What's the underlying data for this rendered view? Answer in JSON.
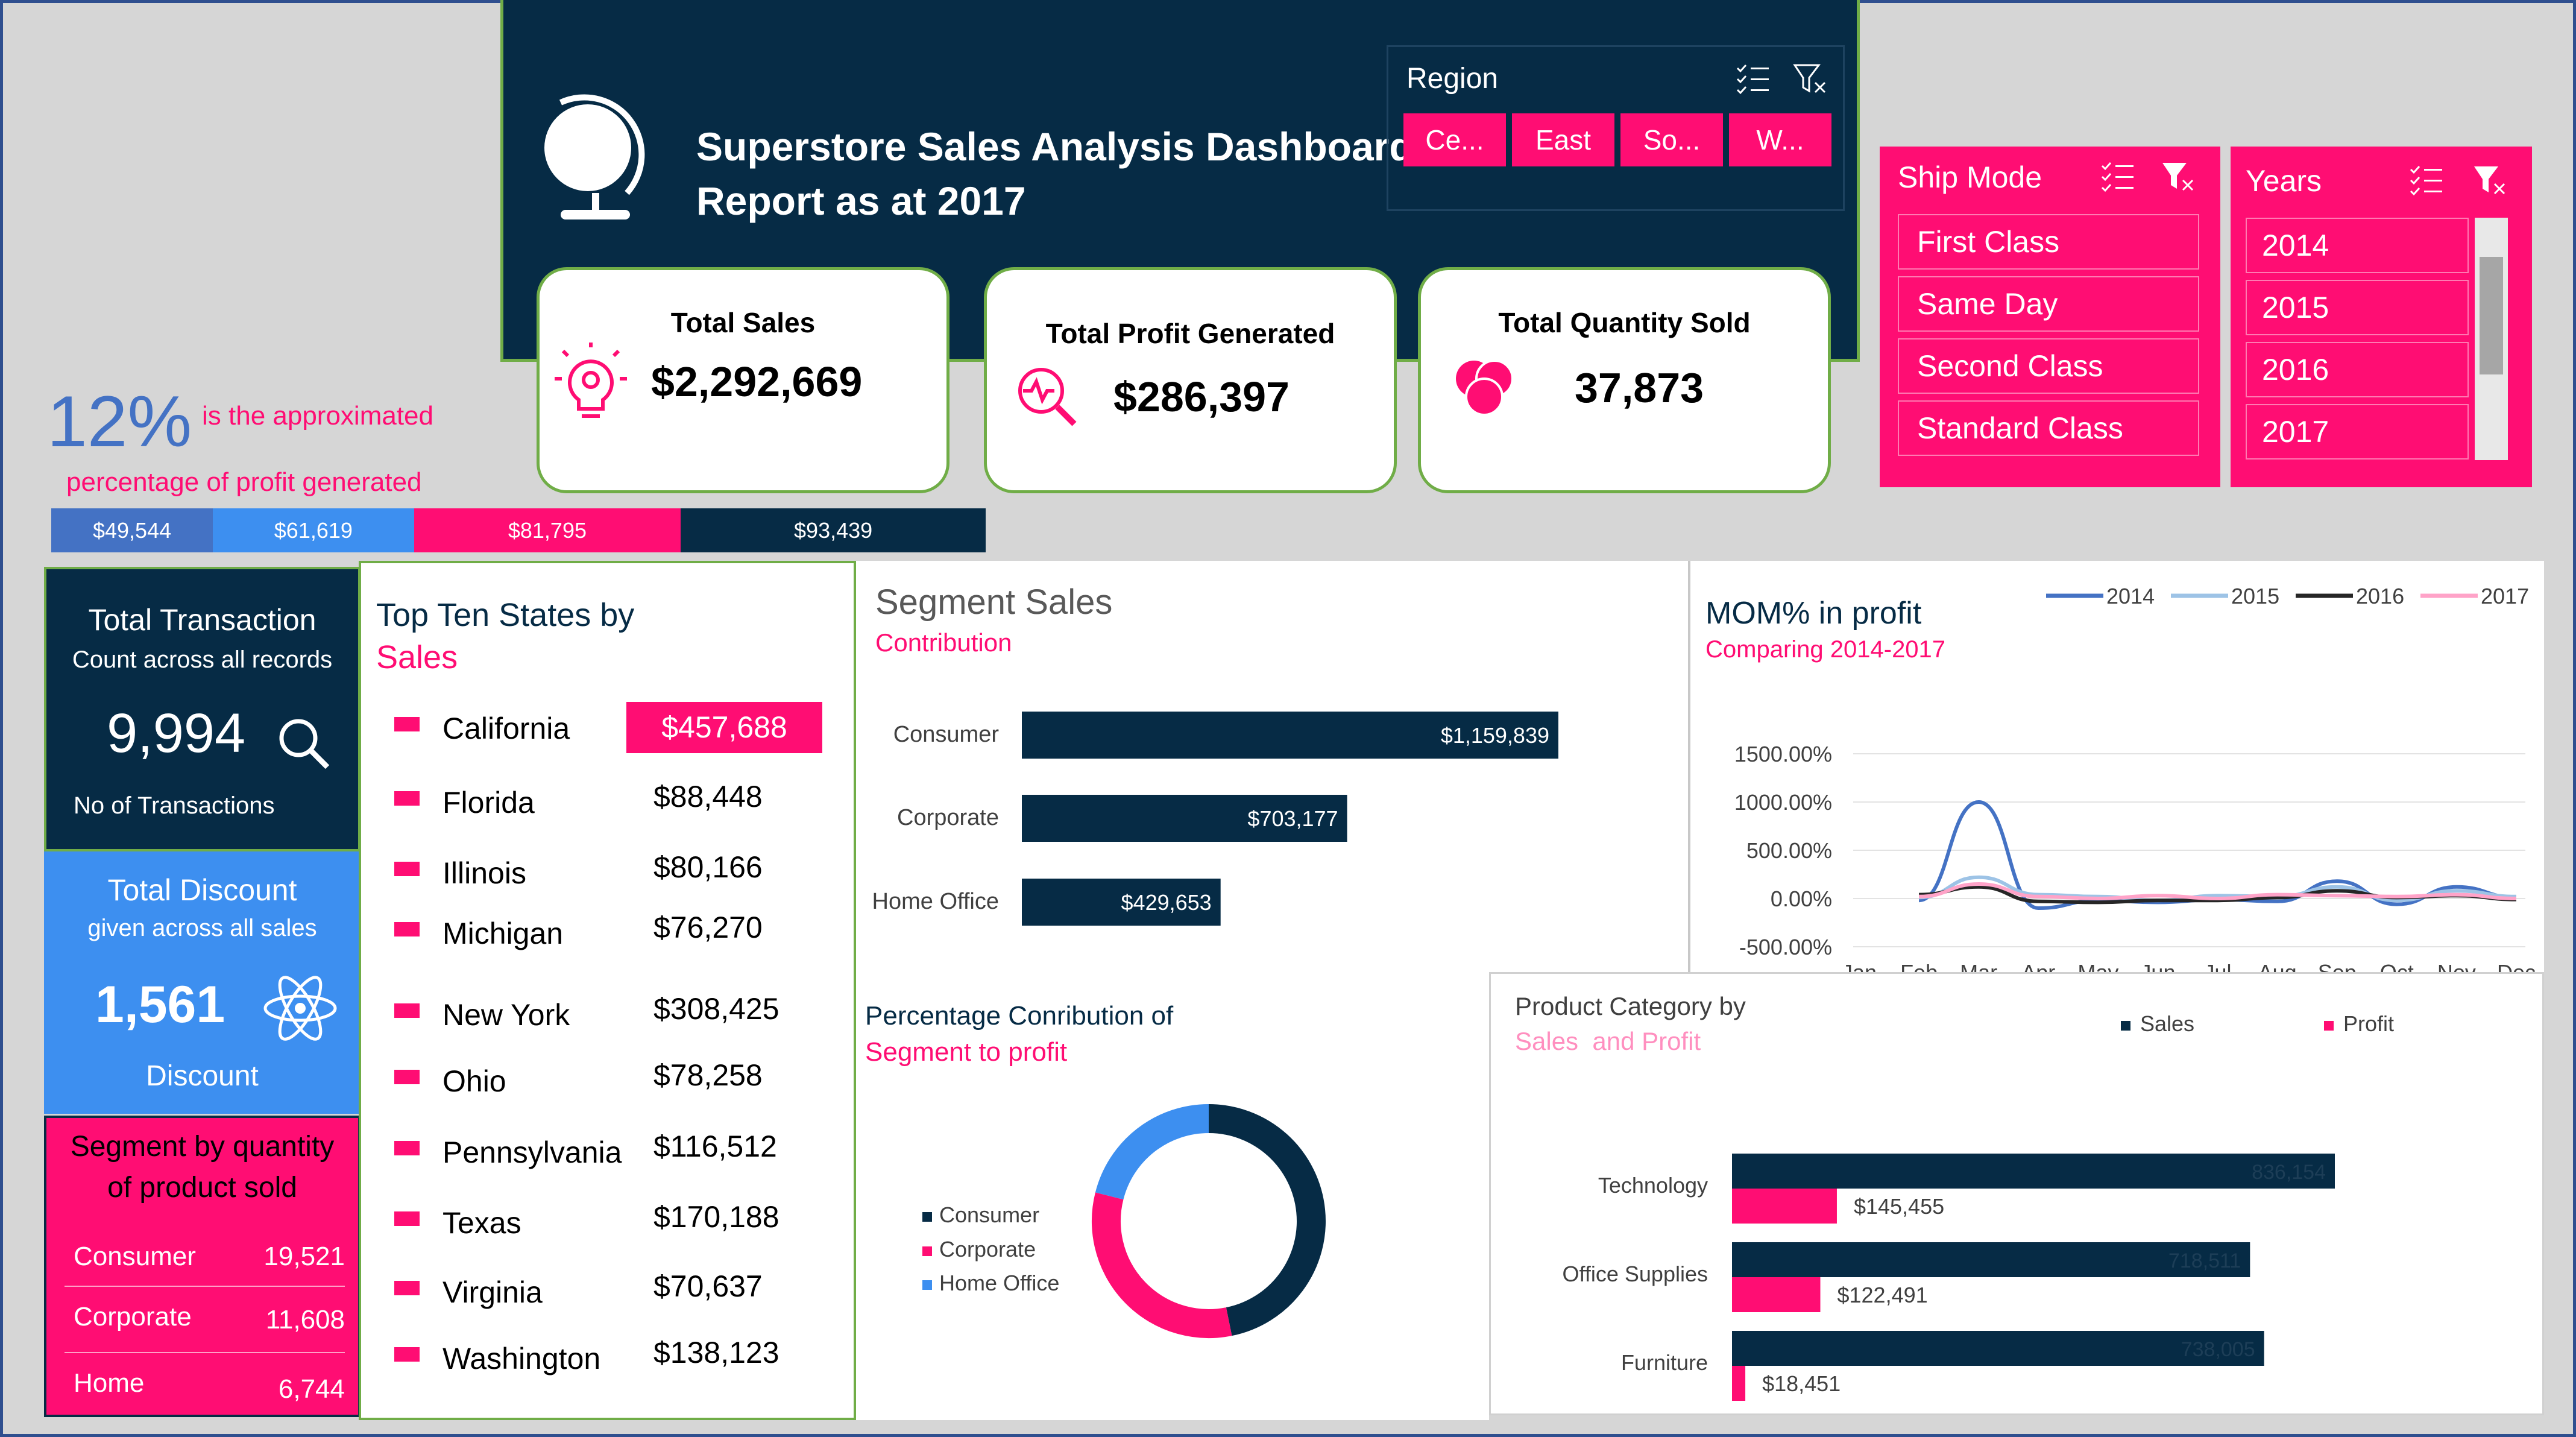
{
  "header": {
    "title_line1": "Superstore Sales Analysis Dashboard",
    "title_line2": "Report as at 2017"
  },
  "region_slicer": {
    "title": "Region",
    "options": [
      "Ce...",
      "East",
      "So...",
      "W..."
    ]
  },
  "kpis": {
    "sales": {
      "label": "Total Sales",
      "value": "$2,292,669"
    },
    "profit": {
      "label": "Total Profit Generated",
      "value": "$286,397"
    },
    "quantity": {
      "label": "Total Quantity Sold",
      "value": "37,873"
    }
  },
  "ship_mode_slicer": {
    "title": "Ship Mode",
    "options": [
      "First Class",
      "Same Day",
      "Second Class",
      "Standard Class"
    ]
  },
  "years_slicer": {
    "title": "Years",
    "options": [
      "2014",
      "2015",
      "2016",
      "2017"
    ]
  },
  "profit_pct": {
    "value": "12%",
    "text1": "is the approximated",
    "text2": "percentage of profit generated",
    "segments": [
      {
        "label": "$49,544",
        "amount": 49544,
        "color": "#4472c4"
      },
      {
        "label": "$61,619",
        "amount": 61619,
        "color": "#3d8ff0"
      },
      {
        "label": "$81,795",
        "amount": 81795,
        "color": "#ff0d73"
      },
      {
        "label": "$93,439",
        "amount": 93439,
        "color": "#062b45"
      }
    ]
  },
  "transactions": {
    "title": "Total Transaction",
    "subtitle": "Count across all records",
    "value": "9,994",
    "caption": "No of Transactions"
  },
  "discount": {
    "title": "Total Discount",
    "subtitle": "given across all sales",
    "value": "1,561",
    "caption": "Discount"
  },
  "segment_quantity": {
    "title_line1": "Segment by quantity",
    "title_line2": "of product sold",
    "rows": [
      {
        "name": "Consumer",
        "value": "19,521"
      },
      {
        "name": "Corporate",
        "value": "11,608"
      },
      {
        "name": "Home",
        "value": "6,744"
      }
    ]
  },
  "top_states": {
    "title_line1": "Top Ten States by",
    "title_line2": "Sales",
    "rows": [
      {
        "state": "California",
        "sales": "$457,688"
      },
      {
        "state": "Florida",
        "sales": "$88,448"
      },
      {
        "state": "Illinois",
        "sales": "$80,166"
      },
      {
        "state": "Michigan",
        "sales": "$76,270"
      },
      {
        "state": "New York",
        "sales": "$308,425"
      },
      {
        "state": "Ohio",
        "sales": "$78,258"
      },
      {
        "state": "Pennsylvania",
        "sales": "$116,512"
      },
      {
        "state": "Texas",
        "sales": "$170,188"
      },
      {
        "state": "Virginia",
        "sales": "$70,637"
      },
      {
        "state": "Washington",
        "sales": "$138,123"
      }
    ]
  },
  "colors": {
    "navy": "#062b45",
    "pink": "#ff0d73",
    "blue": "#3d8ff0",
    "light_pink": "#ff8fbf",
    "green_border": "#70ad47"
  },
  "chart_data": [
    {
      "type": "bar",
      "orientation": "horizontal",
      "title": "Segment Sales",
      "subtitle": "Contribution",
      "categories": [
        "Consumer",
        "Corporate",
        "Home Office"
      ],
      "values": [
        1159839,
        703177,
        429653
      ],
      "value_labels": [
        "$1,159,839",
        "$703,177",
        "$429,653"
      ]
    },
    {
      "type": "line",
      "title": "MOM% in profit",
      "subtitle": "Comparing 2014-2017",
      "x": [
        "Jan",
        "Feb",
        "Mar",
        "Apr",
        "May",
        "Jun",
        "Jul",
        "Aug",
        "Sep",
        "Oct",
        "Nov",
        "Dec"
      ],
      "ylim": [
        -500,
        1500
      ],
      "yticks": [
        "1500.00%",
        "1000.00%",
        "500.00%",
        "0.00%",
        "-500.00%"
      ],
      "yvalues": [
        1500,
        1000,
        500,
        0,
        -500
      ],
      "legend": "top-right",
      "series": [
        {
          "name": "2014",
          "color": "#4472c4",
          "values": [
            null,
            -20,
            1000,
            -100,
            -20,
            -40,
            -10,
            -30,
            180,
            -60,
            120,
            10
          ]
        },
        {
          "name": "2015",
          "color": "#9dc3e6",
          "values": [
            null,
            10,
            220,
            40,
            20,
            -20,
            30,
            20,
            120,
            -20,
            80,
            20
          ]
        },
        {
          "name": "2016",
          "color": "#262626",
          "values": [
            null,
            40,
            120,
            -30,
            -40,
            -20,
            -20,
            10,
            80,
            10,
            30,
            -10
          ]
        },
        {
          "name": "2017",
          "color": "#ffa3c8",
          "values": [
            null,
            20,
            150,
            20,
            0,
            30,
            0,
            40,
            30,
            20,
            40,
            0
          ]
        }
      ]
    },
    {
      "type": "pie",
      "donut": true,
      "title_line1": "Percentage Conribution of",
      "title_line2": "Segment to profit",
      "categories": [
        "Consumer",
        "Corporate",
        "Home Office"
      ],
      "values": [
        134119,
        91979,
        60299
      ],
      "colors": [
        "#062b45",
        "#ff0d73",
        "#3d8ff0"
      ],
      "legend": "left"
    },
    {
      "type": "bar",
      "orientation": "horizontal",
      "title": "Product Category by",
      "subtitle": "Sales  and Profit",
      "categories": [
        "Technology",
        "Office Supplies",
        "Furniture"
      ],
      "legend": "top",
      "series": [
        {
          "name": "Sales",
          "color": "#062b45",
          "values": [
            836154,
            718511,
            738005
          ],
          "labels": [
            "836,154",
            "718,511",
            "738,005"
          ]
        },
        {
          "name": "Profit",
          "color": "#ff0d73",
          "values": [
            145455,
            122491,
            18451
          ],
          "labels": [
            "$145,455",
            "$122,491",
            "$18,451"
          ]
        }
      ]
    }
  ]
}
